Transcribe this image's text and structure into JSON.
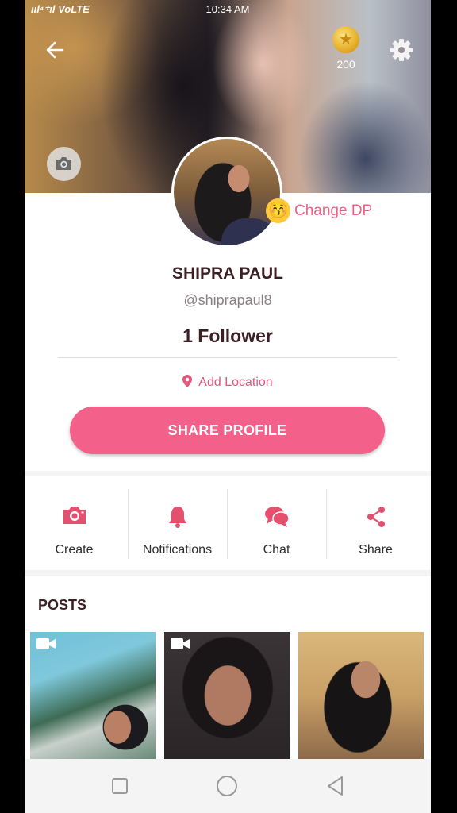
{
  "status_bar": {
    "signal": "ııl⁴⁺ıl VoLTE",
    "time": "10:34 AM"
  },
  "header": {
    "coins": "200"
  },
  "profile": {
    "change_dp_label": "Change DP",
    "emoji": "😚",
    "name": "SHIPRA PAUL",
    "handle": "@shiprapaul8",
    "followers": "1 Follower",
    "location_label": "Add Location",
    "share_button": "SHARE PROFILE"
  },
  "actions": [
    {
      "label": "Create",
      "icon": "camera-icon"
    },
    {
      "label": "Notifications",
      "icon": "bell-icon"
    },
    {
      "label": "Chat",
      "icon": "chat-bubbles-icon"
    },
    {
      "label": "Share",
      "icon": "share-icon"
    }
  ],
  "posts": {
    "title": "POSTS",
    "items": [
      {
        "type": "video",
        "icon": "video-icon"
      },
      {
        "type": "video",
        "icon": "video-icon"
      },
      {
        "type": "image"
      }
    ]
  },
  "colors": {
    "accent": "#f3608a",
    "accent_text": "#e2577c",
    "dark_text": "#3c1f25"
  }
}
